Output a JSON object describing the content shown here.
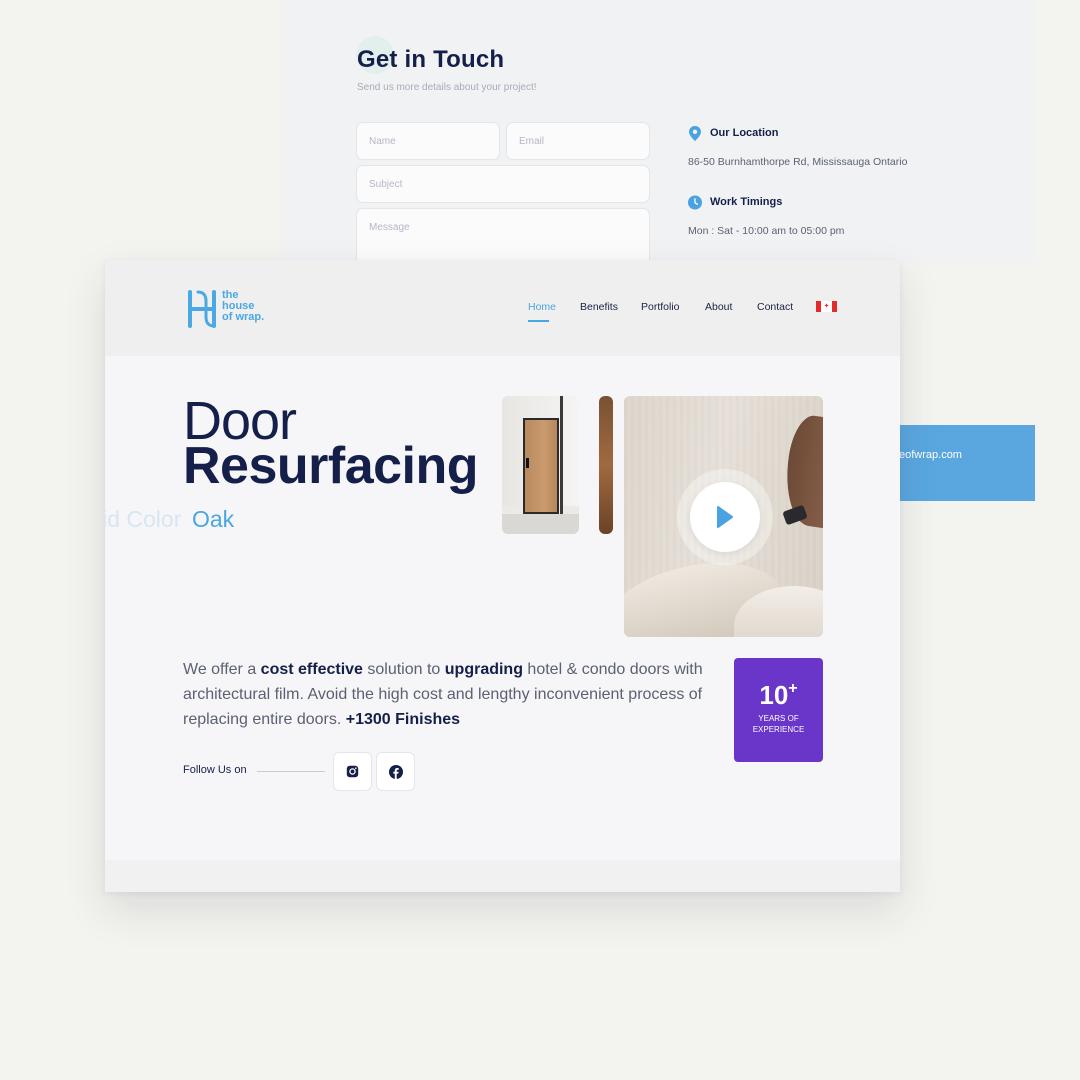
{
  "contact": {
    "title": "Get in Touch",
    "subtitle": "Send us more details about your project!",
    "form": {
      "name_placeholder": "Name",
      "email_placeholder": "Email",
      "subject_placeholder": "Subject",
      "message_placeholder": "Message"
    },
    "location": {
      "title": "Our Location",
      "text": "86-50 Burnhamthorpe Rd, Mississauga Ontario"
    },
    "timings": {
      "title": "Work Timings",
      "text": "Mon : Sat - 10:00 am to 05:00 pm"
    },
    "email_fragment": "eofwrap.com"
  },
  "site": {
    "logo_text": [
      "the",
      "house",
      "of wrap."
    ],
    "nav": [
      {
        "label": "Home",
        "active": true
      },
      {
        "label": "Benefits"
      },
      {
        "label": "Portfolio"
      },
      {
        "label": "About"
      },
      {
        "label": "Contact"
      }
    ],
    "flag": "canada-flag",
    "hero": {
      "title_light": "Door",
      "title_bold": "Resurfacing",
      "rotating_faded": "lid Color",
      "rotating_active": "Oak"
    },
    "description": {
      "parts": [
        {
          "text": "We offer a ",
          "bold": false
        },
        {
          "text": "cost effective",
          "bold": true
        },
        {
          "text": " solution to ",
          "bold": false
        },
        {
          "text": "upgrading",
          "bold": true
        },
        {
          "text": " hotel & condo doors with architectural film. Avoid the high cost and lengthy inconvenient process of replacing entire doors. ",
          "bold": false
        },
        {
          "text": "+1300 Finishes",
          "bold": true
        }
      ]
    },
    "badge": {
      "number": "10",
      "plus": "+",
      "label_line1": "YEARS OF",
      "label_line2": "EXPERIENCE"
    },
    "follow_label": "Follow Us on",
    "social": [
      "instagram-icon",
      "facebook-icon"
    ],
    "colors": {
      "accent": "#49a6df",
      "navy": "#15204a",
      "badge": "#6a36c9"
    }
  }
}
